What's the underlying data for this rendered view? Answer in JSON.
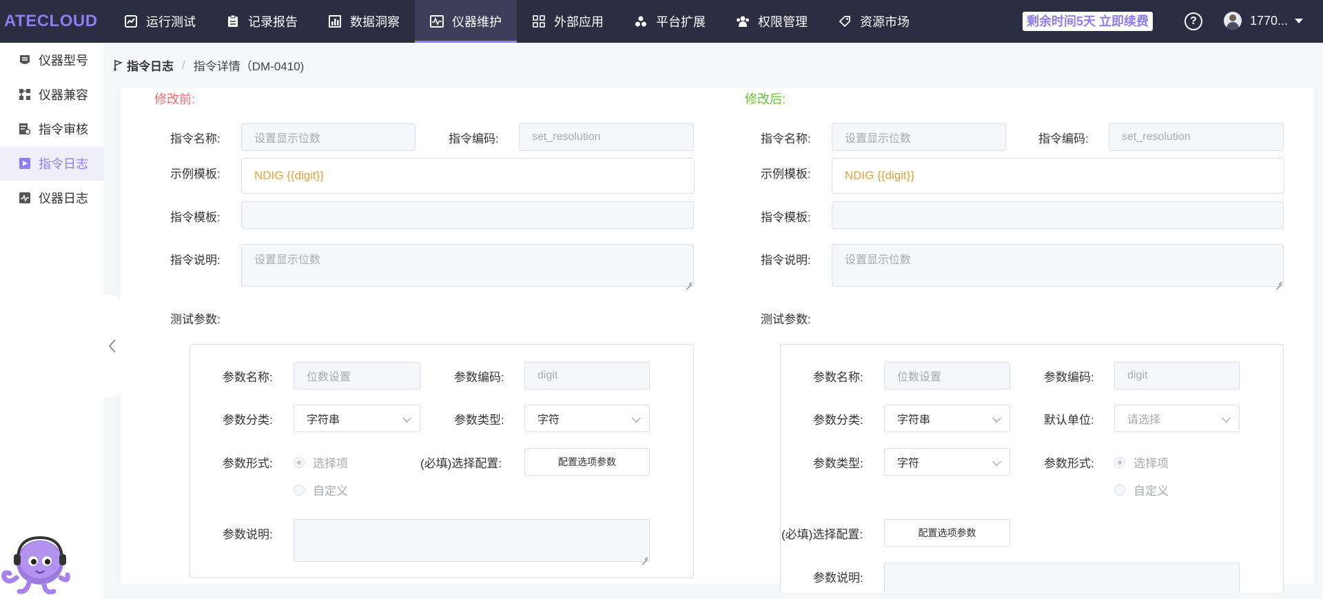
{
  "app": {
    "logo": "ATECLOUD"
  },
  "nav": [
    {
      "label": "运行测试",
      "icon": "chart-icon"
    },
    {
      "label": "记录报告",
      "icon": "clipboard-icon"
    },
    {
      "label": "数据洞察",
      "icon": "bar-chart-icon"
    },
    {
      "label": "仪器维护",
      "icon": "monitor-wave-icon",
      "active": true
    },
    {
      "label": "外部应用",
      "icon": "grid-icon"
    },
    {
      "label": "平台扩展",
      "icon": "nodes-icon"
    },
    {
      "label": "权限管理",
      "icon": "users-icon"
    },
    {
      "label": "资源市场",
      "icon": "tag-icon"
    }
  ],
  "header": {
    "renew": "剩余时间5天 立即续费",
    "help": "?",
    "user": "1770..."
  },
  "sidebar": {
    "items": [
      {
        "label": "仪器型号",
        "icon": "device-icon"
      },
      {
        "label": "仪器兼容",
        "icon": "compat-icon"
      },
      {
        "label": "指令审核",
        "icon": "audit-icon"
      },
      {
        "label": "指令日志",
        "icon": "log-icon",
        "active": true
      },
      {
        "label": "仪器日志",
        "icon": "device-log-icon"
      }
    ]
  },
  "breadcrumb": {
    "first": "指令日志",
    "separator": "/",
    "current": "指令详情（DM-0410)"
  },
  "before": {
    "title": "修改前:",
    "title_color": "#f56c6c",
    "labels": {
      "name": "指令名称:",
      "code": "指令编码:",
      "example": "示例模板:",
      "template": "指令模板:",
      "desc": "指令说明:",
      "test_params": "测试参数:"
    },
    "name_value": "设置显示位数",
    "code_value": "set_resolution",
    "example_value": "NDIG {{digit}}",
    "template_value": "",
    "desc_value": "设置显示位数",
    "param": {
      "labels": {
        "name": "参数名称:",
        "code": "参数编码:",
        "category": "参数分类:",
        "type": "参数类型:",
        "form": "参数形式:",
        "config": "(必填)选择配置:",
        "desc": "参数说明:"
      },
      "name_value": "位数设置",
      "code_value": "digit",
      "category_value": "字符串",
      "type_value": "字符",
      "form_options": [
        "选择项",
        "自定义"
      ],
      "config_button": "配置选项参数",
      "desc_value": ""
    }
  },
  "after": {
    "title": "修改后:",
    "title_color": "#67c23a",
    "labels": {
      "name": "指令名称:",
      "code": "指令编码:",
      "example": "示例模板:",
      "template": "指令模板:",
      "desc": "指令说明:",
      "test_params": "测试参数:"
    },
    "name_value": "设置显示位数",
    "code_value": "set_resolution",
    "example_value": "NDIG {{digit}}",
    "template_value": "",
    "desc_value": "设置显示位数",
    "param": {
      "labels": {
        "name": "参数名称:",
        "code": "参数编码:",
        "category": "参数分类:",
        "unit": "默认单位:",
        "type": "参数类型:",
        "form": "参数形式:",
        "config": "(必填)选择配置:",
        "desc": "参数说明:"
      },
      "name_value": "位数设置",
      "code_value": "digit",
      "category_value": "字符串",
      "unit_placeholder": "请选择",
      "type_value": "字符",
      "form_options": [
        "选择项",
        "自定义"
      ],
      "config_button": "配置选项参数"
    }
  },
  "colors": {
    "topbar": "#2b2d42",
    "accent": "#8f7cf0",
    "template_text": "#e6a23c"
  }
}
